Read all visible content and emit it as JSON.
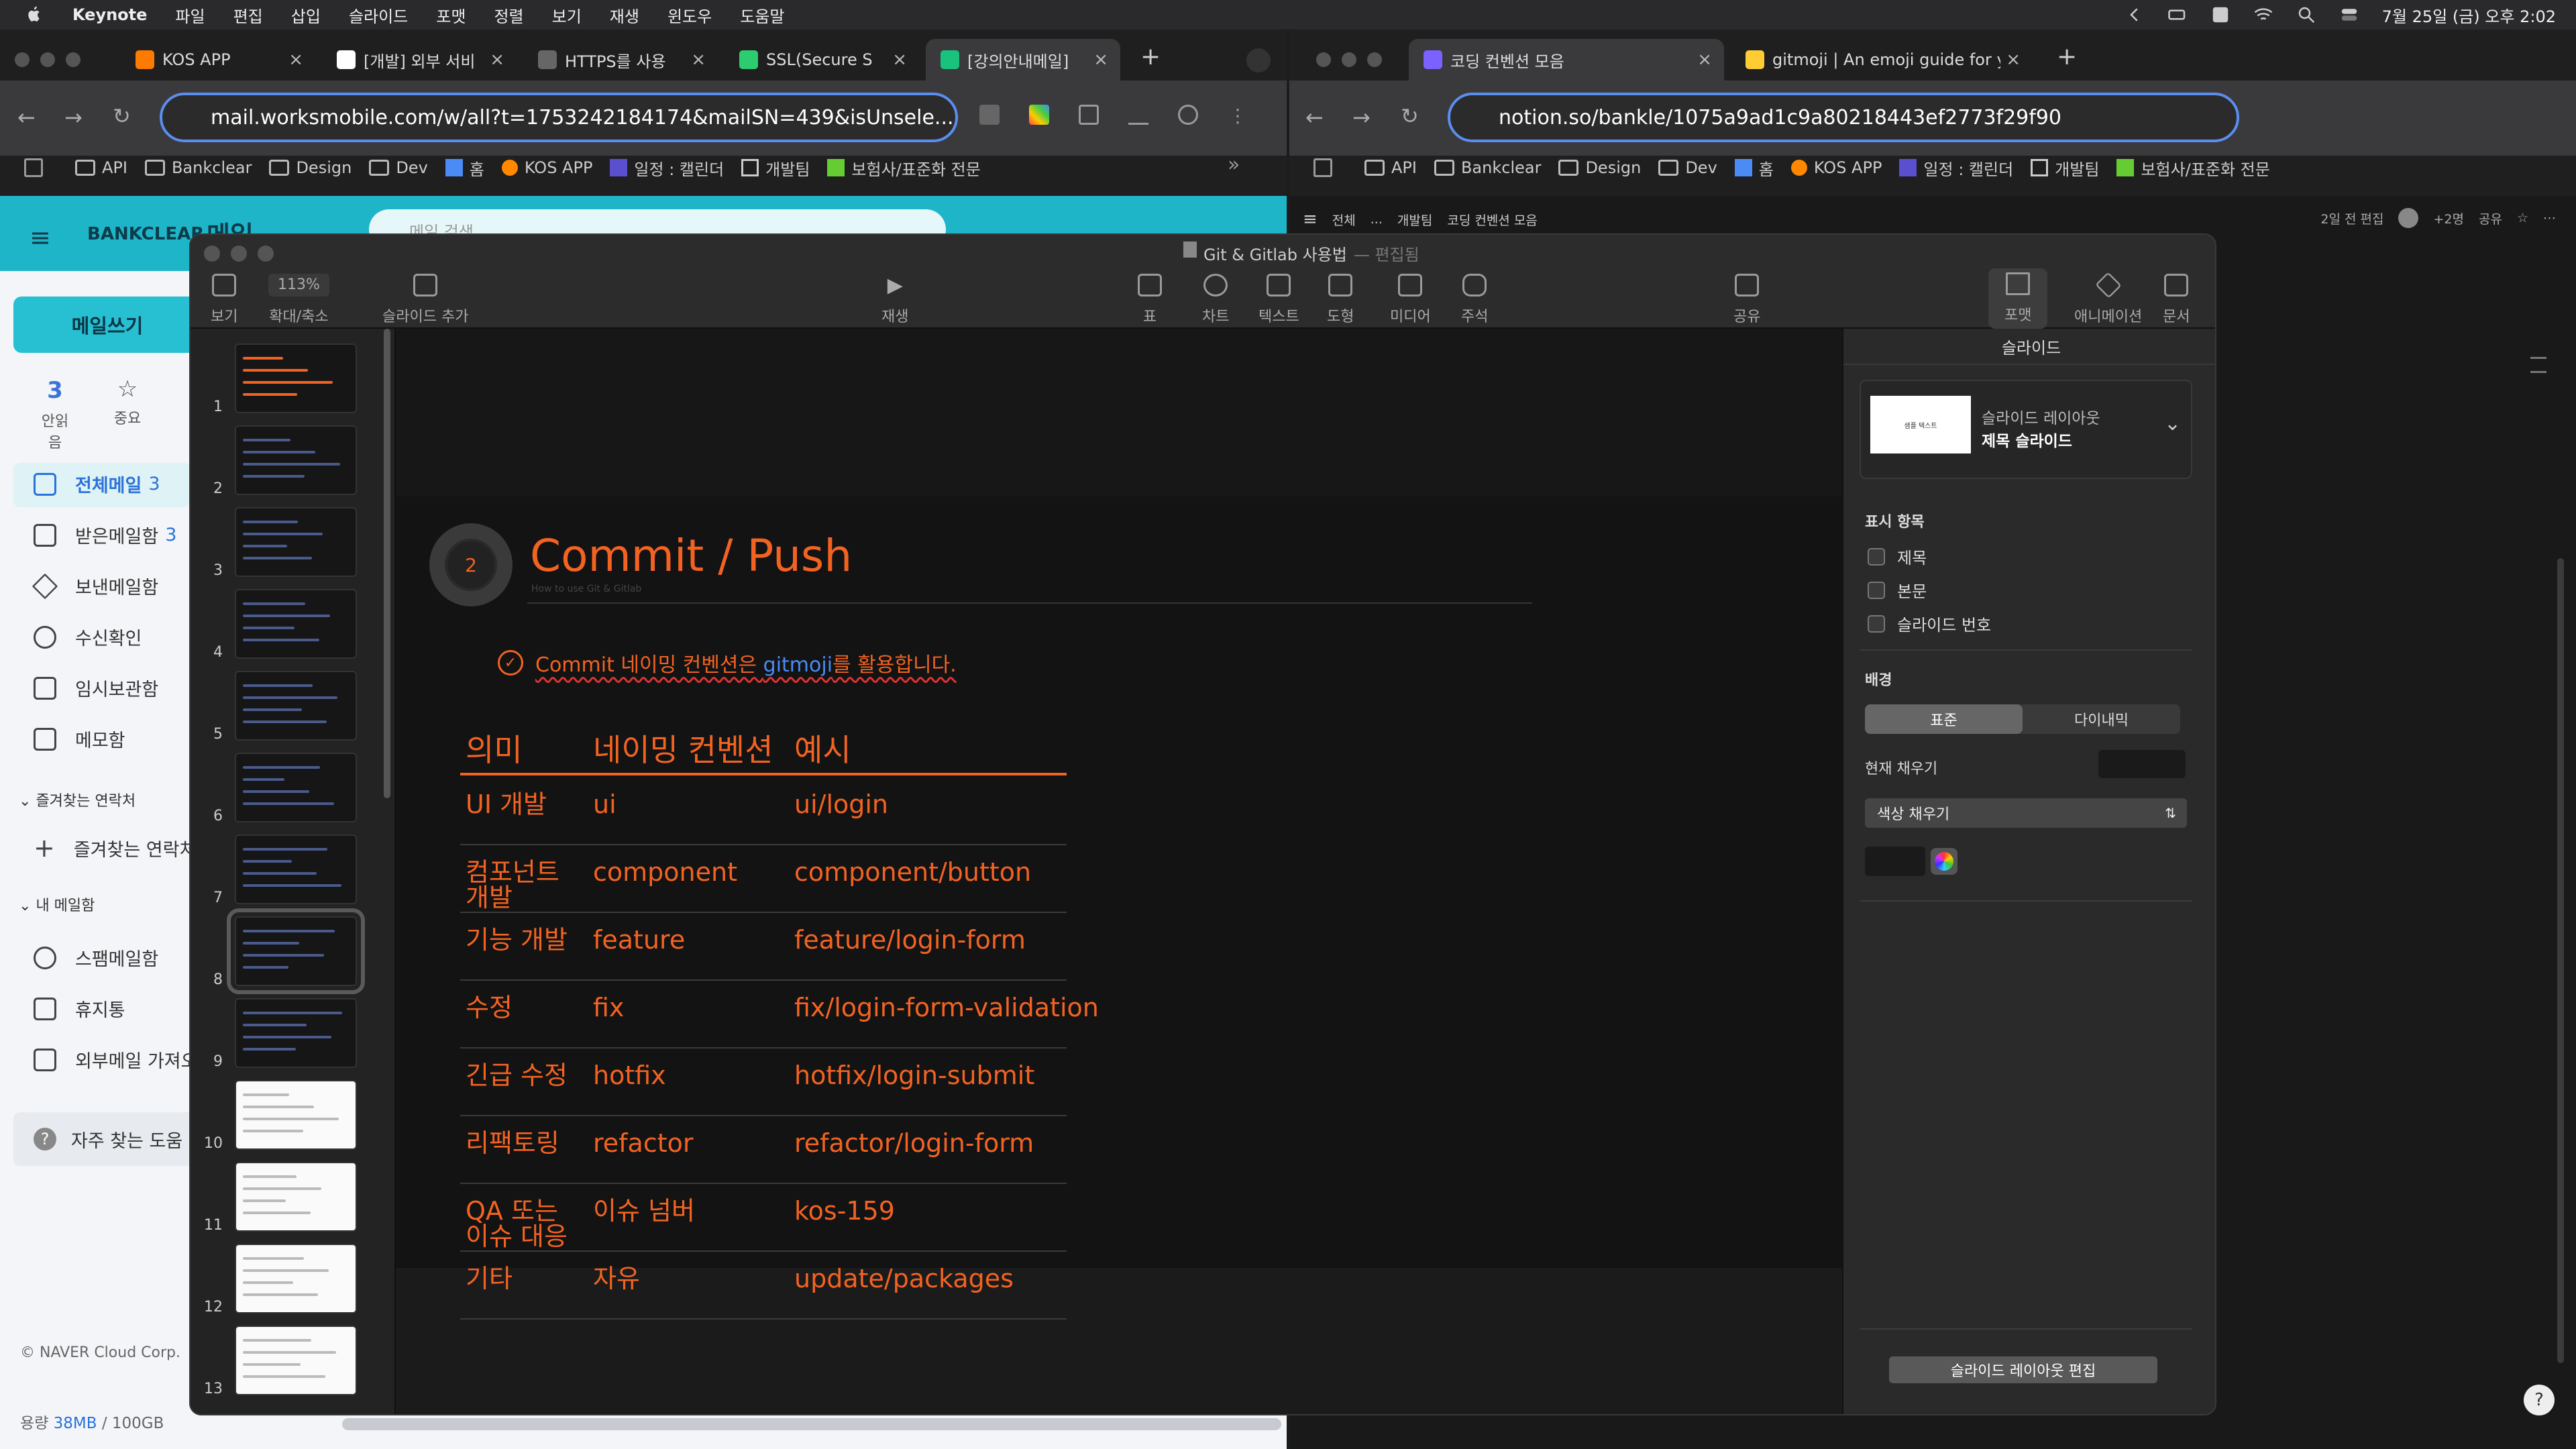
{
  "menubar": {
    "app": "Keynote",
    "items": [
      "파일",
      "편집",
      "삽입",
      "슬라이드",
      "포맷",
      "정렬",
      "보기",
      "재생",
      "윈도우",
      "도움말"
    ],
    "clock": "7월 25일 (금) 오후 2:02"
  },
  "left_browser": {
    "tabs": [
      {
        "label": "KOS APP",
        "fav": "#ff7a00"
      },
      {
        "label": "[개발] 외부 서비",
        "fav": "#ffffff"
      },
      {
        "label": "HTTPS를 사용",
        "fav": "#666666"
      },
      {
        "label": "SSL(Secure S",
        "fav": "#2ecc71"
      },
      {
        "label": "[강의안내메일]",
        "fav": "#19c37d"
      }
    ],
    "url": "mail.worksmobile.com/w/all?t=1753242184174&mailSN=439&isUnsele...",
    "bookmarks": [
      "API",
      "Bankclear",
      "Design",
      "Dev",
      "홈",
      "KOS APP",
      "일정 : 캘린더",
      "개발팀",
      "보험사/표준화 전문"
    ]
  },
  "mail": {
    "brand": "BANKCLEAR",
    "header": "메일",
    "search_placeholder": "메일 검색",
    "compose": "메일쓰기",
    "stats": [
      {
        "count": "3",
        "label": "안읽음"
      },
      {
        "count": "",
        "label": "중요"
      }
    ],
    "folders": [
      {
        "label": "전체메일",
        "count": "3",
        "active": true
      },
      {
        "label": "받은메일함",
        "count": "3",
        "active": false
      },
      {
        "label": "보낸메일함",
        "count": "",
        "active": false
      },
      {
        "label": "수신확인",
        "count": "",
        "active": false
      },
      {
        "label": "임시보관함",
        "count": "",
        "active": false
      },
      {
        "label": "메모함",
        "count": "",
        "active": false
      }
    ],
    "section_fav": "즐겨찾는 연락처",
    "fav_add": "즐겨찾는 연락처",
    "section_my": "내 메일함",
    "my_folders": [
      "스팸메일함",
      "휴지통",
      "외부메일 가져오"
    ],
    "help": "자주 찾는 도움",
    "copyright": "© NAVER Cloud Corp.",
    "storage_label": "용량",
    "storage_used": "38MB",
    "storage_total": "/ 100GB"
  },
  "right_browser": {
    "tabs": [
      {
        "label": "코딩 컨벤션 모음",
        "fav": "#7b61ff"
      },
      {
        "label": "gitmoji | An emoji guide for yo",
        "fav": "#ffcc33"
      }
    ],
    "url": "notion.so/bankle/1075a9ad1c9a80218443ef2773f29f90",
    "bookmarks": [
      "API",
      "Bankclear",
      "Design",
      "Dev",
      "홈",
      "KOS APP",
      "일정 : 캘린더",
      "개발팀",
      "보험사/표준화 전문"
    ],
    "breadcrumb": [
      "전체",
      "...",
      "개발팀",
      "코딩 컨벤션 모음"
    ],
    "edited": "2일 전 편집",
    "share": "공유",
    "more_people": "+2명"
  },
  "keynote": {
    "title": "Git & Gitlab 사용법",
    "subtitle": "— 편집됨",
    "zoom": "113%",
    "tools_left": [
      "보기",
      "확대/축소",
      "슬라이드 추가"
    ],
    "play": "재생",
    "tools_mid": [
      "표",
      "차트",
      "텍스트",
      "도형",
      "미디어",
      "주석"
    ],
    "share": "공유",
    "tools_right": [
      "포맷",
      "애니메이션",
      "문서"
    ],
    "thumb_numbers": [
      "1",
      "2",
      "3",
      "4",
      "5",
      "6",
      "7",
      "8",
      "9",
      "10",
      "11",
      "12",
      "13"
    ],
    "slide": {
      "badge": "2",
      "heading": "Commit / Push",
      "sub": "How to use Git & Gitlab",
      "note_pre": "Commit 네이밍 컨벤션은 ",
      "note_link": "gitmoji",
      "note_post": "를 활용합니다.",
      "headers": [
        "의미",
        "네이밍 컨벤션",
        "예시"
      ],
      "rows": [
        [
          "UI 개발",
          "ui",
          "ui/login"
        ],
        [
          "컴포넌트 개발",
          "component",
          "component/button"
        ],
        [
          "기능 개발",
          "feature",
          "feature/login-form"
        ],
        [
          "수정",
          "fix",
          "fix/login-form-validation"
        ],
        [
          "긴급 수정",
          "hotfix",
          "hotfix/login-submit"
        ],
        [
          "리팩토링",
          "refactor",
          "refactor/login-form"
        ],
        [
          "QA 또는 이슈 대응",
          "이슈 넘버",
          "kos-159"
        ],
        [
          "기타",
          "자유",
          "update/packages"
        ]
      ]
    },
    "inspector": {
      "title": "슬라이드",
      "layout_label": "슬라이드 레이아웃",
      "layout_value": "제목 슬라이드",
      "layout_thumb_text": "샘플 텍스트",
      "display_title": "표시 항목",
      "display_items": [
        "제목",
        "본문",
        "슬라이드 번호"
      ],
      "bg_title": "배경",
      "bg_options": [
        "표준",
        "다이내믹"
      ],
      "fill_label": "현재 채우기",
      "fill_select": "색상 채우기",
      "edit_button": "슬라이드 레이아웃 편집"
    }
  }
}
